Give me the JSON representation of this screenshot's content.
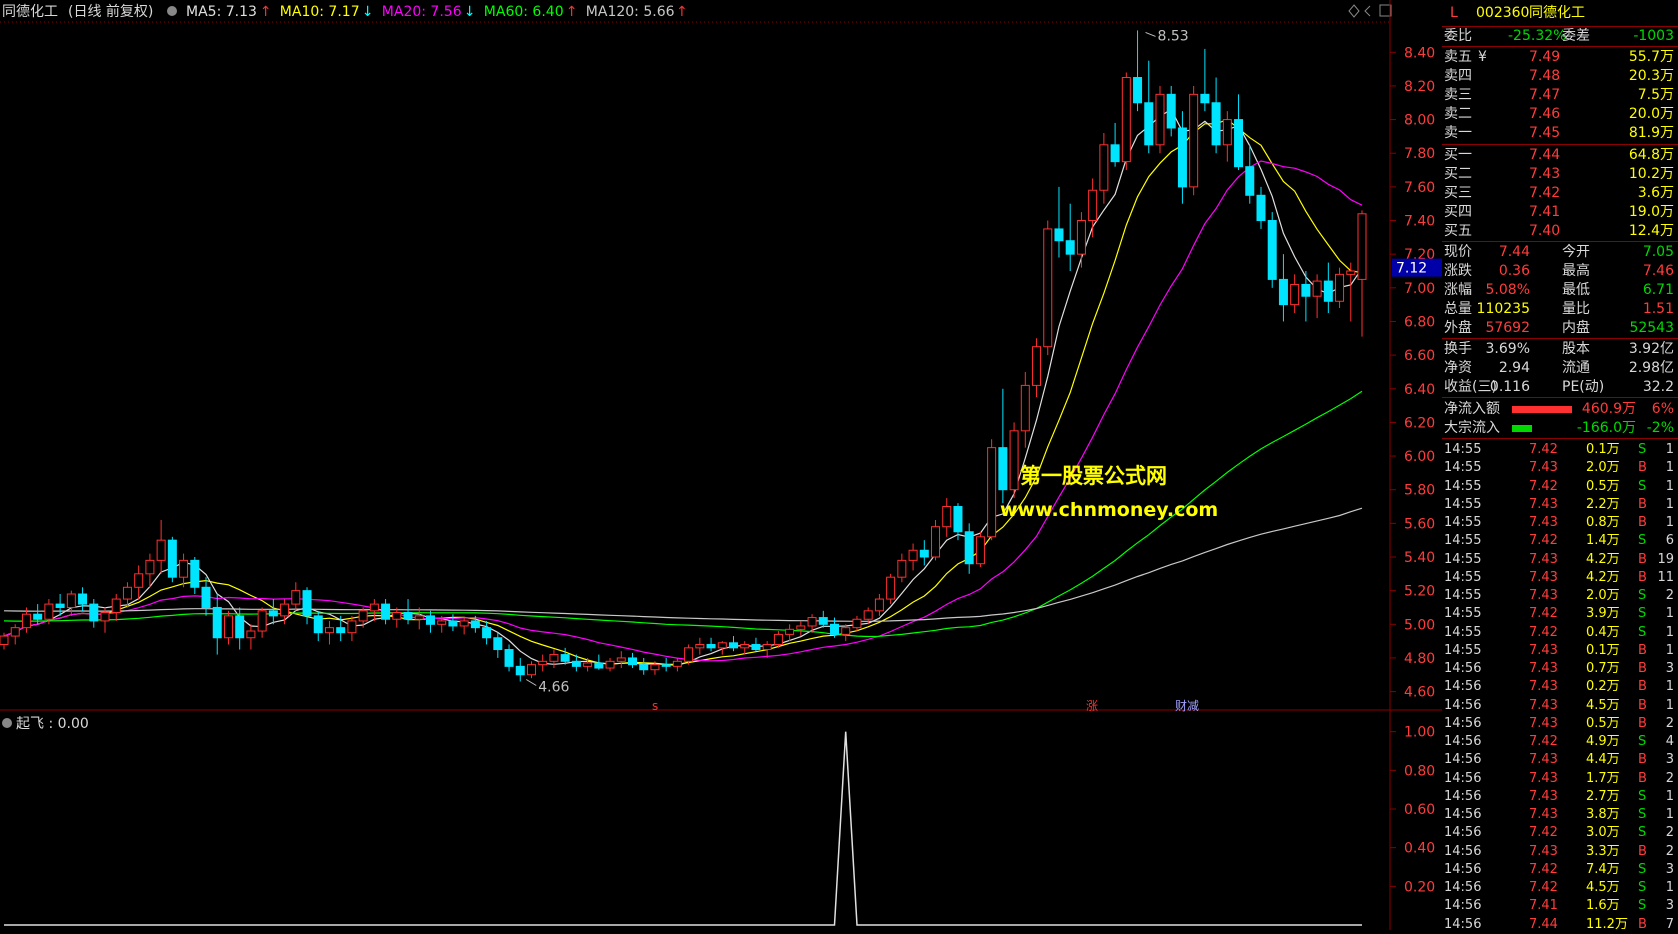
{
  "chart_header": {
    "stock_name": "同德化工",
    "mode": "(日线 前复权)",
    "indicators": [
      {
        "label": "MA5:",
        "value": "7.13",
        "arrow": "↑",
        "color": "#e0e0e0"
      },
      {
        "label": "MA10:",
        "value": "7.17",
        "arrow": "↓",
        "color": "#ffff00"
      },
      {
        "label": "MA20:",
        "value": "7.56",
        "arrow": "↓",
        "color": "#ff00ff"
      },
      {
        "label": "MA60:",
        "value": "6.40",
        "arrow": "↑",
        "color": "#00ff00"
      },
      {
        "label": "MA120:",
        "value": "5.66",
        "arrow": "↑",
        "color": "#c8c8c8"
      }
    ]
  },
  "price_axis": [
    "8.40",
    "8.20",
    "8.00",
    "7.80",
    "7.60",
    "7.40",
    "7.20",
    "7.00",
    "6.80",
    "6.60",
    "6.40",
    "6.20",
    "6.00",
    "5.80",
    "5.60",
    "5.40",
    "5.20",
    "5.00",
    "4.80",
    "4.60"
  ],
  "current_price_tag": "7.12",
  "high_label": "8.53",
  "low_label": "4.66",
  "event_marks": [
    {
      "text": "s",
      "color": "#ff3030"
    },
    {
      "text": "涨",
      "color": "#ff3030"
    },
    {
      "text": "财减",
      "color": "#a0a0ff"
    }
  ],
  "watermark": {
    "line1": "第一股票公式网",
    "line2": "www.chnmoney.com"
  },
  "sub_indicator": {
    "label": "起飞 : 0.00",
    "axis": [
      "1.00",
      "0.80",
      "0.60",
      "0.40",
      "0.20"
    ]
  },
  "chart_data": {
    "type": "candlestick",
    "price_ylim": [
      4.55,
      8.58
    ],
    "candles_ohlc": [
      [
        4.88,
        4.95,
        4.85,
        4.93
      ],
      [
        4.93,
        5.0,
        4.88,
        4.98
      ],
      [
        4.98,
        5.1,
        4.95,
        5.06
      ],
      [
        5.06,
        5.12,
        5.0,
        5.03
      ],
      [
        5.03,
        5.15,
        5.0,
        5.12
      ],
      [
        5.12,
        5.18,
        5.05,
        5.1
      ],
      [
        5.1,
        5.2,
        5.05,
        5.18
      ],
      [
        5.18,
        5.22,
        5.08,
        5.12
      ],
      [
        5.12,
        5.15,
        4.98,
        5.02
      ],
      [
        5.02,
        5.1,
        4.95,
        5.07
      ],
      [
        5.07,
        5.18,
        5.02,
        5.15
      ],
      [
        5.15,
        5.25,
        5.1,
        5.22
      ],
      [
        5.22,
        5.35,
        5.15,
        5.3
      ],
      [
        5.3,
        5.42,
        5.22,
        5.38
      ],
      [
        5.38,
        5.62,
        5.3,
        5.5
      ],
      [
        5.5,
        5.52,
        5.25,
        5.28
      ],
      [
        5.28,
        5.42,
        5.22,
        5.38
      ],
      [
        5.38,
        5.4,
        5.18,
        5.22
      ],
      [
        5.22,
        5.28,
        5.05,
        5.1
      ],
      [
        5.1,
        5.18,
        4.82,
        4.92
      ],
      [
        4.92,
        5.08,
        4.88,
        5.05
      ],
      [
        5.05,
        5.1,
        4.85,
        4.92
      ],
      [
        4.92,
        5.0,
        4.85,
        4.96
      ],
      [
        4.96,
        5.1,
        4.92,
        5.08
      ],
      [
        5.08,
        5.15,
        5.0,
        5.05
      ],
      [
        5.05,
        5.15,
        5.0,
        5.12
      ],
      [
        5.12,
        5.25,
        5.08,
        5.2
      ],
      [
        5.2,
        5.22,
        5.0,
        5.05
      ],
      [
        5.05,
        5.08,
        4.9,
        4.95
      ],
      [
        4.95,
        5.02,
        4.88,
        4.98
      ],
      [
        4.98,
        5.05,
        4.9,
        4.95
      ],
      [
        4.95,
        5.05,
        4.9,
        5.02
      ],
      [
        5.02,
        5.1,
        4.98,
        5.08
      ],
      [
        5.08,
        5.15,
        5.02,
        5.12
      ],
      [
        5.12,
        5.15,
        5.0,
        5.03
      ],
      [
        5.03,
        5.1,
        4.98,
        5.07
      ],
      [
        5.07,
        5.15,
        5.0,
        5.03
      ],
      [
        5.03,
        5.1,
        4.97,
        5.05
      ],
      [
        5.05,
        5.08,
        4.95,
        5.0
      ],
      [
        5.0,
        5.05,
        4.95,
        5.02
      ],
      [
        5.02,
        5.06,
        4.96,
        4.99
      ],
      [
        4.99,
        5.04,
        4.94,
        5.02
      ],
      [
        5.02,
        5.05,
        4.95,
        4.98
      ],
      [
        4.98,
        5.02,
        4.88,
        4.92
      ],
      [
        4.92,
        4.95,
        4.8,
        4.85
      ],
      [
        4.85,
        4.88,
        4.72,
        4.75
      ],
      [
        4.75,
        4.8,
        4.66,
        4.7
      ],
      [
        4.7,
        4.78,
        4.68,
        4.76
      ],
      [
        4.76,
        4.82,
        4.72,
        4.78
      ],
      [
        4.78,
        4.85,
        4.74,
        4.82
      ],
      [
        4.82,
        4.86,
        4.76,
        4.78
      ],
      [
        4.78,
        4.82,
        4.72,
        4.75
      ],
      [
        4.75,
        4.8,
        4.72,
        4.77
      ],
      [
        4.77,
        4.82,
        4.73,
        4.74
      ],
      [
        4.74,
        4.8,
        4.72,
        4.78
      ],
      [
        4.78,
        4.84,
        4.74,
        4.8
      ],
      [
        4.8,
        4.83,
        4.74,
        4.76
      ],
      [
        4.76,
        4.8,
        4.7,
        4.73
      ],
      [
        4.73,
        4.78,
        4.7,
        4.76
      ],
      [
        4.76,
        4.8,
        4.72,
        4.75
      ],
      [
        4.75,
        4.8,
        4.72,
        4.78
      ],
      [
        4.78,
        4.88,
        4.76,
        4.86
      ],
      [
        4.86,
        4.92,
        4.82,
        4.88
      ],
      [
        4.88,
        4.92,
        4.84,
        4.86
      ],
      [
        4.86,
        4.9,
        4.82,
        4.89
      ],
      [
        4.89,
        4.93,
        4.84,
        4.86
      ],
      [
        4.86,
        4.9,
        4.82,
        4.88
      ],
      [
        4.88,
        4.92,
        4.84,
        4.85
      ],
      [
        4.85,
        4.9,
        4.8,
        4.88
      ],
      [
        4.88,
        4.96,
        4.86,
        4.94
      ],
      [
        4.94,
        5.0,
        4.9,
        4.97
      ],
      [
        4.97,
        5.02,
        4.93,
        4.99
      ],
      [
        4.99,
        5.06,
        4.95,
        5.04
      ],
      [
        5.04,
        5.08,
        4.98,
        5.0
      ],
      [
        5.0,
        5.04,
        4.92,
        4.94
      ],
      [
        4.94,
        5.0,
        4.9,
        4.98
      ],
      [
        4.98,
        5.05,
        4.96,
        5.03
      ],
      [
        5.03,
        5.1,
        5.0,
        5.08
      ],
      [
        5.08,
        5.18,
        5.05,
        5.15
      ],
      [
        5.15,
        5.3,
        5.12,
        5.28
      ],
      [
        5.28,
        5.42,
        5.25,
        5.38
      ],
      [
        5.38,
        5.48,
        5.32,
        5.44
      ],
      [
        5.44,
        5.5,
        5.35,
        5.4
      ],
      [
        5.4,
        5.62,
        5.38,
        5.58
      ],
      [
        5.58,
        5.75,
        5.52,
        5.7
      ],
      [
        5.7,
        5.72,
        5.5,
        5.55
      ],
      [
        5.55,
        5.6,
        5.3,
        5.36
      ],
      [
        5.36,
        5.55,
        5.34,
        5.52
      ],
      [
        5.52,
        6.1,
        5.5,
        6.05
      ],
      [
        6.05,
        6.4,
        5.72,
        5.8
      ],
      [
        5.8,
        6.2,
        5.75,
        6.15
      ],
      [
        6.15,
        6.5,
        6.05,
        6.42
      ],
      [
        6.42,
        6.7,
        6.35,
        6.65
      ],
      [
        6.65,
        7.4,
        6.6,
        7.35
      ],
      [
        7.35,
        7.6,
        7.18,
        7.28
      ],
      [
        7.28,
        7.5,
        7.1,
        7.2
      ],
      [
        7.2,
        7.45,
        7.12,
        7.4
      ],
      [
        7.4,
        7.65,
        7.3,
        7.58
      ],
      [
        7.58,
        7.92,
        7.5,
        7.85
      ],
      [
        7.85,
        7.98,
        7.72,
        7.75
      ],
      [
        7.75,
        8.28,
        7.7,
        8.25
      ],
      [
        8.25,
        8.53,
        8.05,
        8.1
      ],
      [
        8.1,
        8.35,
        7.8,
        7.85
      ],
      [
        7.85,
        8.2,
        7.8,
        8.15
      ],
      [
        8.15,
        8.2,
        7.9,
        7.95
      ],
      [
        7.95,
        8.05,
        7.5,
        7.6
      ],
      [
        7.6,
        8.2,
        7.55,
        8.15
      ],
      [
        8.15,
        8.42,
        8.05,
        8.1
      ],
      [
        8.1,
        8.25,
        7.8,
        7.85
      ],
      [
        7.85,
        8.05,
        7.75,
        8.0
      ],
      [
        8.0,
        8.15,
        7.7,
        7.72
      ],
      [
        7.72,
        7.85,
        7.5,
        7.55
      ],
      [
        7.55,
        7.6,
        7.35,
        7.4
      ],
      [
        7.4,
        7.45,
        7.0,
        7.05
      ],
      [
        7.05,
        7.2,
        6.8,
        6.9
      ],
      [
        6.9,
        7.08,
        6.85,
        7.02
      ],
      [
        7.02,
        7.1,
        6.8,
        6.95
      ],
      [
        6.95,
        7.08,
        6.82,
        7.04
      ],
      [
        7.04,
        7.15,
        6.85,
        6.92
      ],
      [
        6.92,
        7.12,
        6.88,
        7.08
      ],
      [
        7.08,
        7.15,
        6.8,
        7.1
      ],
      [
        7.05,
        7.46,
        6.71,
        7.44
      ]
    ],
    "sub_ylim": [
      0,
      1.05
    ],
    "signal_index": 75,
    "signal_value": 1.0
  },
  "quote": {
    "code_prefix": "L",
    "code": "002360",
    "name": "同德化工",
    "weibi_label": "委比",
    "weibi": "-25.32%",
    "weicha_label": "委差",
    "weicha": "-1003",
    "asks": [
      {
        "label": "卖五",
        "extra": "¥",
        "price": "7.49",
        "vol": "55.7万"
      },
      {
        "label": "卖四",
        "extra": "",
        "price": "7.48",
        "vol": "20.3万"
      },
      {
        "label": "卖三",
        "extra": "",
        "price": "7.47",
        "vol": "7.5万"
      },
      {
        "label": "卖二",
        "extra": "",
        "price": "7.46",
        "vol": "20.0万"
      },
      {
        "label": "卖一",
        "extra": "",
        "price": "7.45",
        "vol": "81.9万"
      }
    ],
    "bids": [
      {
        "label": "买一",
        "price": "7.44",
        "vol": "64.8万"
      },
      {
        "label": "买二",
        "price": "7.43",
        "vol": "10.2万"
      },
      {
        "label": "买三",
        "price": "7.42",
        "vol": "3.6万"
      },
      {
        "label": "买四",
        "price": "7.41",
        "vol": "19.0万"
      },
      {
        "label": "买五",
        "price": "7.40",
        "vol": "12.4万"
      }
    ],
    "stats": [
      {
        "l1": "现价",
        "v1": "7.44",
        "c1": "#ff3c3c",
        "l2": "今开",
        "v2": "7.05",
        "c2": "#00d900"
      },
      {
        "l1": "涨跌",
        "v1": "0.36",
        "c1": "#ff3c3c",
        "l2": "最高",
        "v2": "7.46",
        "c2": "#ff3c3c"
      },
      {
        "l1": "涨幅",
        "v1": "5.08%",
        "c1": "#ff3c3c",
        "l2": "最低",
        "v2": "6.71",
        "c2": "#00d900"
      },
      {
        "l1": "总量",
        "v1": "110235",
        "c1": "#ffff00",
        "l2": "量比",
        "v2": "1.51",
        "c2": "#ff3c3c"
      },
      {
        "l1": "外盘",
        "v1": "57692",
        "c1": "#ff3c3c",
        "l2": "内盘",
        "v2": "52543",
        "c2": "#00d900"
      }
    ],
    "stats2": [
      {
        "l1": "换手",
        "v1": "3.69%",
        "l2": "股本",
        "v2": "3.92亿"
      },
      {
        "l1": "净资",
        "v1": "2.94",
        "l2": "流通",
        "v2": "2.98亿"
      },
      {
        "l1": "收益(三)",
        "v1": "0.116",
        "l2": "PE(动)",
        "v2": "32.2"
      }
    ],
    "flows": [
      {
        "label": "净流入额",
        "bar_color": "#ff3030",
        "bar_fraction": 0.85,
        "value": "460.9万",
        "value_color": "#ff3c3c",
        "pct": "6%",
        "pct_color": "#ff3c3c"
      },
      {
        "label": "大宗流入",
        "bar_color": "#00d900",
        "bar_fraction": 0.28,
        "value": "-166.0万",
        "value_color": "#00d900",
        "pct": "-2%",
        "pct_color": "#00d900"
      }
    ],
    "ticks": [
      {
        "t": "14:55",
        "p": "7.42",
        "v": "0.1万",
        "s": "S",
        "n": "1"
      },
      {
        "t": "14:55",
        "p": "7.43",
        "v": "2.0万",
        "s": "B",
        "n": "1"
      },
      {
        "t": "14:55",
        "p": "7.42",
        "v": "0.5万",
        "s": "S",
        "n": "1"
      },
      {
        "t": "14:55",
        "p": "7.43",
        "v": "2.2万",
        "s": "B",
        "n": "1"
      },
      {
        "t": "14:55",
        "p": "7.43",
        "v": "0.8万",
        "s": "B",
        "n": "1"
      },
      {
        "t": "14:55",
        "p": "7.42",
        "v": "1.4万",
        "s": "S",
        "n": "6"
      },
      {
        "t": "14:55",
        "p": "7.43",
        "v": "4.2万",
        "s": "B",
        "n": "19"
      },
      {
        "t": "14:55",
        "p": "7.43",
        "v": "4.2万",
        "s": "B",
        "n": "11"
      },
      {
        "t": "14:55",
        "p": "7.43",
        "v": "2.0万",
        "s": "S",
        "n": "2"
      },
      {
        "t": "14:55",
        "p": "7.42",
        "v": "3.9万",
        "s": "S",
        "n": "1"
      },
      {
        "t": "14:55",
        "p": "7.42",
        "v": "0.4万",
        "s": "S",
        "n": "1"
      },
      {
        "t": "14:55",
        "p": "7.43",
        "v": "0.1万",
        "s": "B",
        "n": "1"
      },
      {
        "t": "14:56",
        "p": "7.43",
        "v": "0.7万",
        "s": "B",
        "n": "3"
      },
      {
        "t": "14:56",
        "p": "7.43",
        "v": "0.2万",
        "s": "B",
        "n": "1"
      },
      {
        "t": "14:56",
        "p": "7.43",
        "v": "4.5万",
        "s": "B",
        "n": "1"
      },
      {
        "t": "14:56",
        "p": "7.43",
        "v": "0.5万",
        "s": "B",
        "n": "2"
      },
      {
        "t": "14:56",
        "p": "7.42",
        "v": "4.9万",
        "s": "S",
        "n": "4"
      },
      {
        "t": "14:56",
        "p": "7.43",
        "v": "4.4万",
        "s": "B",
        "n": "3"
      },
      {
        "t": "14:56",
        "p": "7.43",
        "v": "1.7万",
        "s": "B",
        "n": "2"
      },
      {
        "t": "14:56",
        "p": "7.43",
        "v": "2.7万",
        "s": "S",
        "n": "1"
      },
      {
        "t": "14:56",
        "p": "7.43",
        "v": "3.8万",
        "s": "S",
        "n": "1"
      },
      {
        "t": "14:56",
        "p": "7.42",
        "v": "3.0万",
        "s": "S",
        "n": "2"
      },
      {
        "t": "14:56",
        "p": "7.43",
        "v": "3.3万",
        "s": "B",
        "n": "2"
      },
      {
        "t": "14:56",
        "p": "7.42",
        "v": "7.4万",
        "s": "S",
        "n": "3"
      },
      {
        "t": "14:56",
        "p": "7.42",
        "v": "4.5万",
        "s": "S",
        "n": "1"
      },
      {
        "t": "14:56",
        "p": "7.41",
        "v": "1.6万",
        "s": "S",
        "n": "3"
      },
      {
        "t": "14:56",
        "p": "7.44",
        "v": "11.2万",
        "s": "B",
        "n": "7"
      }
    ]
  },
  "colors": {
    "up": "#ff3030",
    "down": "#00e5ff",
    "grid": "#8b0000",
    "ma5": "#e0e0e0",
    "ma10": "#ffff00",
    "ma20": "#ff00ff",
    "ma60": "#00ff00",
    "ma120": "#c8c8c8",
    "watermark": "#ffff00"
  }
}
